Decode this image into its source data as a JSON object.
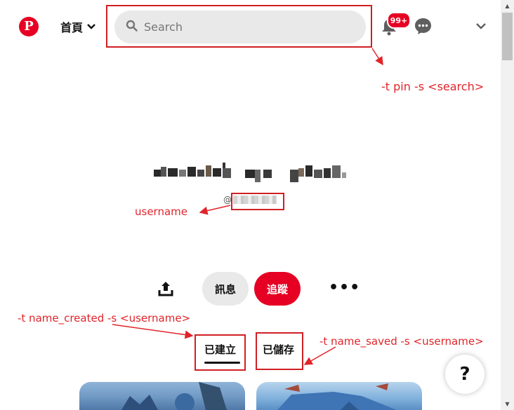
{
  "header": {
    "logo_letter": "P",
    "home_label": "首頁",
    "search_placeholder": "Search",
    "notification_badge": "99+"
  },
  "profile": {
    "username_prefix": "@"
  },
  "actions": {
    "message_label": "訊息",
    "follow_label": "追蹤"
  },
  "tabs": {
    "created_label": "已建立",
    "saved_label": "已儲存"
  },
  "annotations": {
    "search": "-t pin -s <search>",
    "username": "username",
    "created": "-t name_created -s <username>",
    "saved": "-t name_saved -s <username>"
  },
  "help_label": "?",
  "colors": {
    "brand": "#e60023",
    "annotation": "#e0242a"
  },
  "icons": [
    "pinterest-logo",
    "search-icon",
    "bell-icon",
    "chat-icon",
    "chevron-down-icon",
    "share-icon",
    "more-icon",
    "help-icon"
  ]
}
